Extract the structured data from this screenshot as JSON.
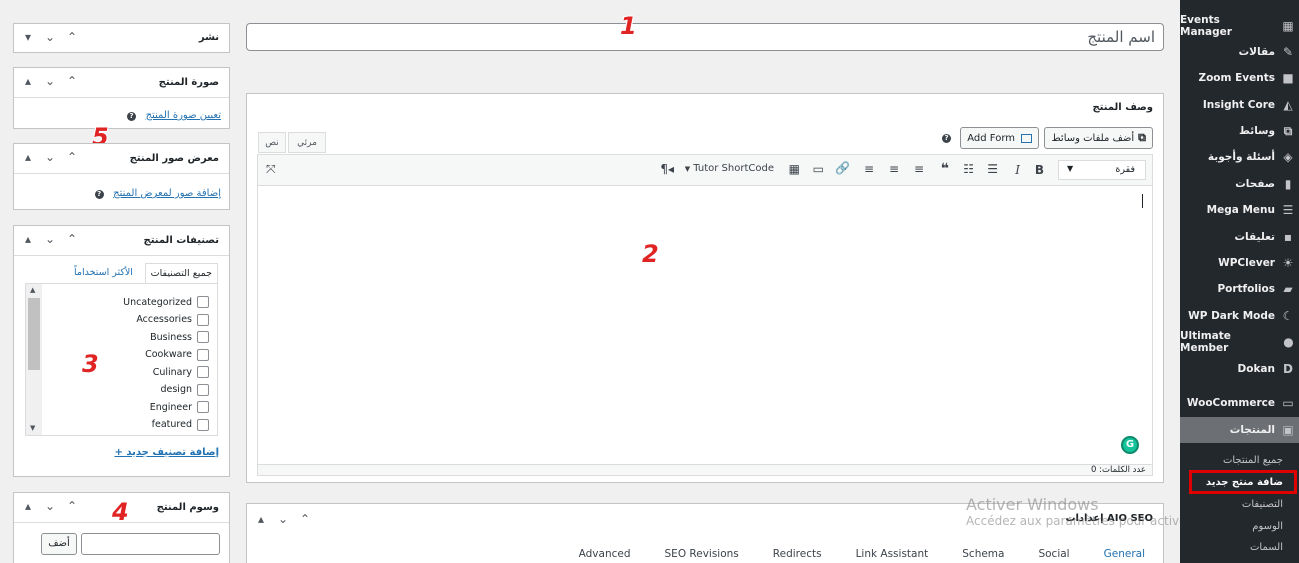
{
  "annotations": {
    "n1": "1",
    "n2": "2",
    "n3": "3",
    "n4": "4",
    "n5": "5"
  },
  "title_input": {
    "value": "اسم المنتج"
  },
  "publish_box": {
    "title": "نشر"
  },
  "product_image_box": {
    "title": "صورة المنتج",
    "link": "تعيين صورة المنتج"
  },
  "gallery_box": {
    "title": "معرض صور المنتج",
    "link": "إضافة صور لمعرض المنتج"
  },
  "categories_box": {
    "title": "تصنيفات المنتج",
    "tab_all": "جميع التصنيفات",
    "tab_popular": "الأكثر استخداماً",
    "items": [
      "Uncategorized",
      "Accessories",
      "Business",
      "Cookware",
      "Culinary",
      "design",
      "Engineer",
      "featured"
    ],
    "add_link": "+ إضافة تصنيف جديد"
  },
  "tags_box": {
    "title": "وسوم المنتج",
    "add_button": "أضف"
  },
  "editor": {
    "title": "وصف المنتج",
    "add_media": "أضف ملفات وسائط",
    "add_form": "Add Form",
    "tab_visual": "مرئي",
    "tab_text": "نص",
    "format_select": "فقرة",
    "tutor_shortcode": "Tutor ShortCode",
    "word_count": "عدد الكلمات: 0",
    "grammarly": "G"
  },
  "seo_box": {
    "title": "إعدادات AIO SEO",
    "tabs": [
      "General",
      "Social",
      "Schema",
      "Link Assistant",
      "Redirects",
      "SEO Revisions",
      "Advanced"
    ]
  },
  "watermark": {
    "line1": "Activer Windows",
    "line2": "Accédez aux paramètres pour activer Windows."
  },
  "sidebar": {
    "items": [
      {
        "label": "Events Manager",
        "icon": "calendar-icon"
      },
      {
        "label": "مقالات",
        "icon": "pin-icon"
      },
      {
        "label": "Zoom Events",
        "icon": "video-icon"
      },
      {
        "label": "Insight Core",
        "icon": "insight-icon"
      },
      {
        "label": "وسائط",
        "icon": "media-icon"
      },
      {
        "label": "أسئلة وأجوبة",
        "icon": "faq-icon"
      },
      {
        "label": "صفحات",
        "icon": "page-icon"
      },
      {
        "label": "Mega Menu",
        "icon": "menu-icon"
      },
      {
        "label": "تعليقات",
        "icon": "comment-icon"
      },
      {
        "label": "WPClever",
        "icon": "bulb-icon"
      },
      {
        "label": "Portfolios",
        "icon": "folder-icon"
      },
      {
        "label": "WP Dark Mode",
        "icon": "moon-icon"
      },
      {
        "label": "Ultimate Member",
        "icon": "user-icon"
      },
      {
        "label": "Dokan",
        "icon": "dokan-icon"
      },
      {
        "label": "WooCommerce",
        "icon": "woo-icon"
      },
      {
        "label": "المنتجات",
        "icon": "products-icon"
      }
    ],
    "submenu": [
      "جميع المنتجات",
      "ضافة منتج جديد",
      "التصنيفات",
      "الوسوم",
      "السمات"
    ]
  },
  "colors": {
    "sidebar": "#23282d",
    "active_menu": "#6c6f73",
    "highlight": "#e00000",
    "link": "#2271b1"
  }
}
